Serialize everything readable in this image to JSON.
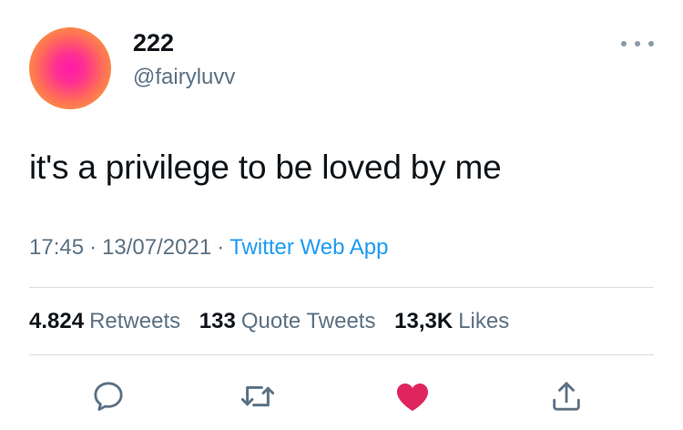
{
  "user": {
    "display_name": "222",
    "handle": "@fairyluvv",
    "avatar_colors": [
      "#ff1aa8",
      "#f2a83a"
    ]
  },
  "tweet": {
    "text": "it's a privilege to be loved by me",
    "time": "17:45",
    "date": "13/07/2021",
    "separator": "·",
    "source": "Twitter Web App"
  },
  "stats": {
    "retweets_count": "4.824",
    "retweets_label": "Retweets",
    "quotes_count": "133",
    "quotes_label": "Quote Tweets",
    "likes_count": "13,3K",
    "likes_label": "Likes"
  },
  "actions": [
    {
      "icon": "reply-icon"
    },
    {
      "icon": "retweet-icon"
    },
    {
      "icon": "like-icon",
      "active": true,
      "color": "#e0245e"
    },
    {
      "icon": "share-icon"
    }
  ],
  "colors": {
    "text": "#0f1419",
    "secondary": "#5b7083",
    "link": "#1d9bf0",
    "like": "#e0245e",
    "icon": "#5b7083"
  }
}
